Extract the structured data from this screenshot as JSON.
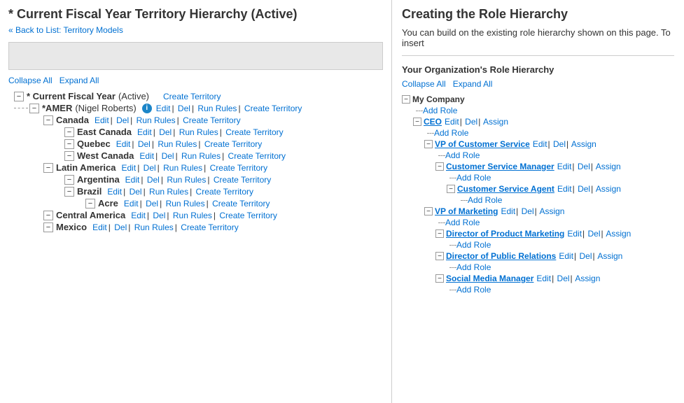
{
  "left": {
    "title": "* Current Fiscal Year Territory Hierarchy (Active)",
    "back_link": "« Back to List: Territory Models",
    "collapse_all": "Collapse All",
    "expand_all": "Expand All",
    "actions": {
      "edit": "Edit",
      "del": "Del",
      "run_rules": "Run Rules",
      "create_territory": "Create Territory",
      "add_role": "Add Role"
    },
    "tree": [
      {
        "id": "root",
        "indent": 0,
        "toggle": "-",
        "label": "* Current Fiscal Year",
        "sublabel": "(Active)",
        "actions": [
          "Create Territory"
        ],
        "children": [
          {
            "id": "amer",
            "indent": 1,
            "toggle": "-",
            "label": "*AMER",
            "sublabel": "(Nigel Roberts)",
            "has_info": true,
            "actions": [
              "Edit",
              "Del",
              "Run Rules",
              "Create Territory"
            ],
            "children": [
              {
                "id": "canada",
                "indent": 2,
                "toggle": "-",
                "label": "Canada",
                "sublabel": "",
                "actions": [
                  "Edit",
                  "Del",
                  "Run Rules",
                  "Create Territory"
                ],
                "children": [
                  {
                    "id": "east-canada",
                    "indent": 3,
                    "toggle": "-",
                    "label": "East Canada",
                    "sublabel": "",
                    "actions": [
                      "Edit",
                      "Del",
                      "Run Rules",
                      "Create Territory"
                    ]
                  },
                  {
                    "id": "quebec",
                    "indent": 3,
                    "toggle": "-",
                    "label": "Quebec",
                    "sublabel": "",
                    "actions": [
                      "Edit",
                      "Del",
                      "Run Rules",
                      "Create Territory"
                    ]
                  },
                  {
                    "id": "west-canada",
                    "indent": 3,
                    "toggle": "-",
                    "label": "West Canada",
                    "sublabel": "",
                    "actions": [
                      "Edit",
                      "Del",
                      "Run Rules",
                      "Create Territory"
                    ]
                  }
                ]
              },
              {
                "id": "latin-america",
                "indent": 2,
                "toggle": "-",
                "label": "Latin America",
                "sublabel": "",
                "actions": [
                  "Edit",
                  "Del",
                  "Run Rules",
                  "Create Territory"
                ],
                "children": [
                  {
                    "id": "argentina",
                    "indent": 3,
                    "toggle": "-",
                    "label": "Argentina",
                    "sublabel": "",
                    "actions": [
                      "Edit",
                      "Del",
                      "Run Rules",
                      "Create Territory"
                    ]
                  },
                  {
                    "id": "brazil",
                    "indent": 3,
                    "toggle": "-",
                    "label": "Brazil",
                    "sublabel": "",
                    "actions": [
                      "Edit",
                      "Del",
                      "Run Rules",
                      "Create Territory"
                    ],
                    "children": [
                      {
                        "id": "acre",
                        "indent": 4,
                        "toggle": "-",
                        "label": "Acre",
                        "sublabel": "",
                        "actions": [
                          "Edit",
                          "Del",
                          "Run Rules",
                          "Create Territory"
                        ]
                      }
                    ]
                  },
                  {
                    "id": "central-america",
                    "indent": 3,
                    "toggle": "-",
                    "label": "Central America",
                    "sublabel": "",
                    "actions": [
                      "Edit",
                      "Del",
                      "Run Rules",
                      "Create Territory"
                    ]
                  },
                  {
                    "id": "mexico",
                    "indent": 3,
                    "toggle": "-",
                    "label": "Mexico",
                    "sublabel": "",
                    "actions": [
                      "Edit",
                      "Del",
                      "Run Rules",
                      "Create Territory"
                    ]
                  }
                ]
              }
            ]
          }
        ]
      }
    ]
  },
  "right": {
    "title": "Creating the Role Hierarchy",
    "description": "You can build on the existing role hierarchy shown on this page. To insert",
    "subtitle": "Your Organization's Role Hierarchy",
    "collapse_all": "Collapse All",
    "expand_all": "Expand All",
    "roles": {
      "name": "My Company",
      "add_role": "Add Role",
      "children": [
        {
          "name": "CEO",
          "actions": [
            "Edit",
            "Del",
            "Assign"
          ],
          "add_role": "Add Role",
          "children": [
            {
              "name": "VP of Customer Service",
              "actions": [
                "Edit",
                "Del",
                "Assign"
              ],
              "add_role": "Add Role",
              "children": [
                {
                  "name": "Customer Service Manager",
                  "actions": [
                    "Edit",
                    "Del",
                    "Assign"
                  ],
                  "add_role": "Add Role",
                  "children": [
                    {
                      "name": "Customer Service Agent",
                      "actions": [
                        "Edit",
                        "Del",
                        "Assign"
                      ],
                      "add_role": "Add Role"
                    }
                  ]
                }
              ]
            },
            {
              "name": "VP of Marketing",
              "actions": [
                "Edit",
                "Del",
                "Assign"
              ],
              "add_role": "Add Role",
              "children": [
                {
                  "name": "Director of Product Marketing",
                  "actions": [
                    "Edit",
                    "Del",
                    "Assign"
                  ],
                  "add_role": "Add Role"
                },
                {
                  "name": "Director of Public Relations",
                  "actions": [
                    "Edit",
                    "Del",
                    "Assign"
                  ],
                  "add_role": "Add Role"
                },
                {
                  "name": "Social Media Manager",
                  "actions": [
                    "Edit",
                    "Del",
                    "Assign"
                  ],
                  "add_role": "Add Role"
                }
              ]
            }
          ]
        }
      ]
    }
  }
}
